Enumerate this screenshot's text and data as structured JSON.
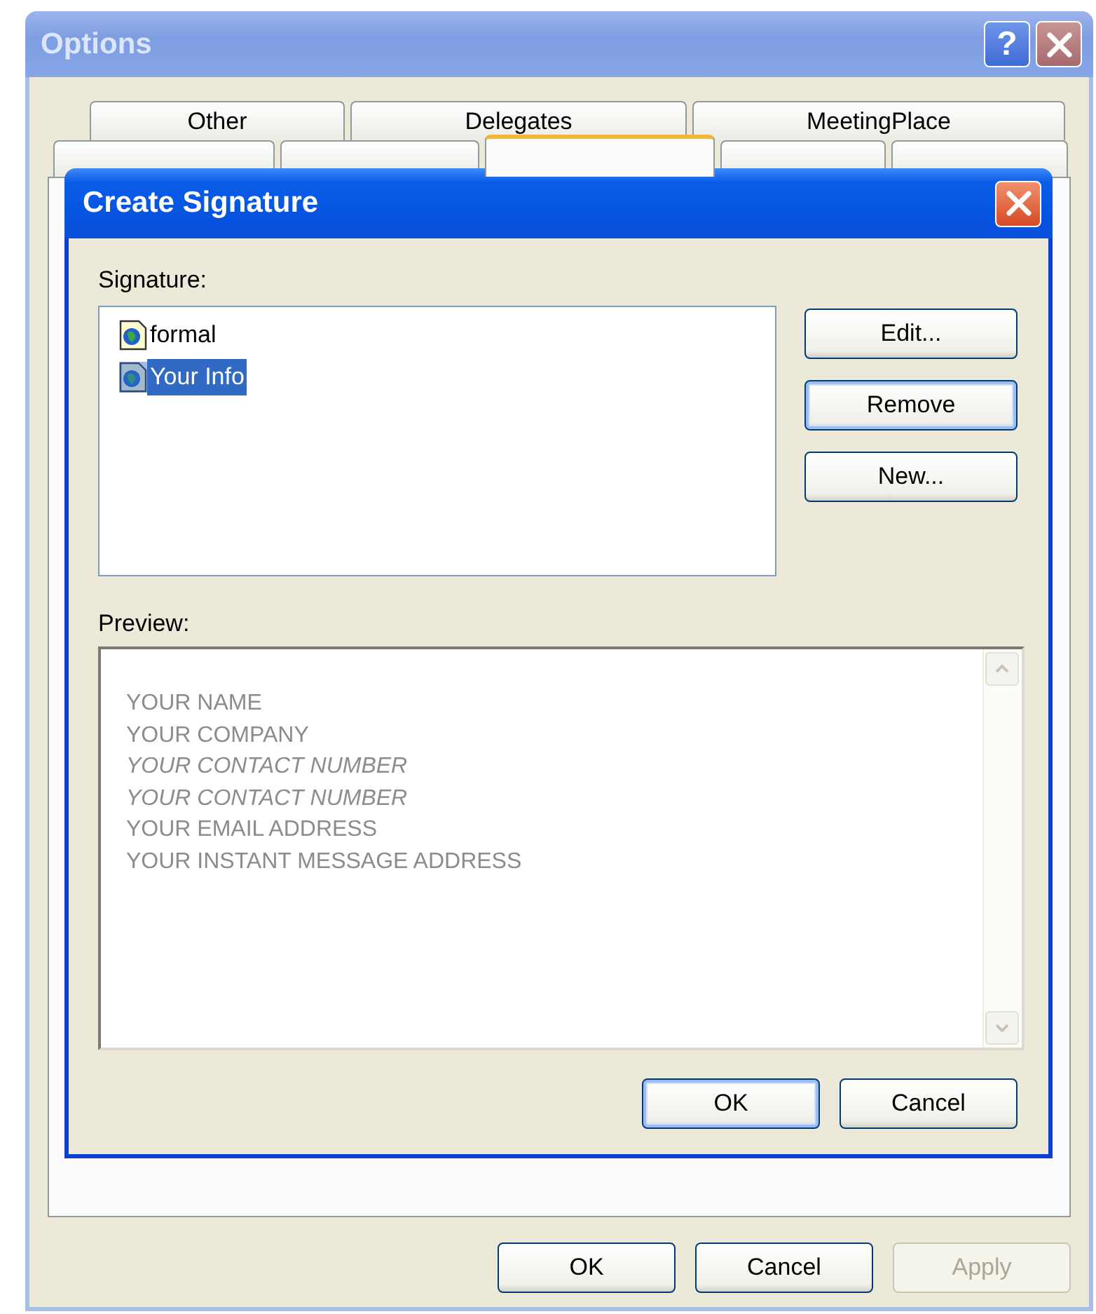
{
  "options_window": {
    "title": "Options",
    "help_button": "?",
    "tabs_row_1": [
      {
        "label": "Other",
        "selected": false
      },
      {
        "label": "Delegates",
        "selected": false
      },
      {
        "label": "MeetingPlace",
        "selected": false
      }
    ],
    "tabs_row_2": [
      {
        "selected": false
      },
      {
        "selected": false
      },
      {
        "selected": true
      },
      {
        "selected": false
      },
      {
        "selected": false
      }
    ],
    "buttons": [
      {
        "label": "OK",
        "disabled": false
      },
      {
        "label": "Cancel",
        "disabled": false
      },
      {
        "label": "Apply",
        "disabled": true
      }
    ]
  },
  "dialog": {
    "title": "Create Signature",
    "signature_label": "Signature:",
    "signatures": [
      {
        "name": "formal",
        "selected": false
      },
      {
        "name": "Your Info",
        "selected": true
      }
    ],
    "side_buttons": [
      {
        "label": "Edit...",
        "focused": false
      },
      {
        "label": "Remove",
        "focused": true
      },
      {
        "label": "New...",
        "focused": false
      }
    ],
    "preview_label": "Preview:",
    "preview_lines": [
      {
        "text": "YOUR NAME",
        "italic": false
      },
      {
        "text": "YOUR COMPANY",
        "italic": false
      },
      {
        "text": "YOUR CONTACT NUMBER",
        "italic": true
      },
      {
        "text": "YOUR CONTACT NUMBER",
        "italic": true
      },
      {
        "text": "YOUR EMAIL ADDRESS",
        "italic": false
      },
      {
        "text": "YOUR INSTANT MESSAGE ADDRESS",
        "italic": false
      }
    ],
    "buttons": [
      {
        "label": "OK",
        "default": true
      },
      {
        "label": "Cancel",
        "default": false
      }
    ]
  }
}
